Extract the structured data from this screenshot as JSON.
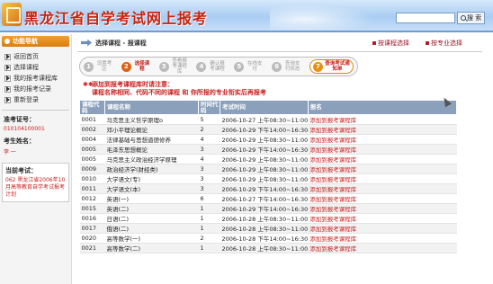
{
  "header": {
    "title": "黑龙江省自学考试网上报考",
    "search_value": "",
    "search_button": "搜 索"
  },
  "sidebar": {
    "heading": "功能导航",
    "items": [
      {
        "label": "返回首页"
      },
      {
        "label": "选择课程"
      },
      {
        "label": "我的报考课程库"
      },
      {
        "label": "我的报考记录"
      },
      {
        "label": "重新登录"
      }
    ],
    "exam_id_label": "准考证号：",
    "exam_id_value": "010104100001",
    "name_label": "考生姓名：",
    "name_value": "李 一",
    "notice_title": "当前考试：",
    "notice_text": "062 黑龙江省2006年10月高等教育自学考试报考计划"
  },
  "main": {
    "breadcrumb": "选择课程 - 报课程",
    "link_by_course": "按课程选择",
    "link_by_major": "按专业选择",
    "steps": [
      {
        "num": "1",
        "label": "设置考区",
        "state": "done"
      },
      {
        "num": "2",
        "label": "选择课程",
        "state": "active"
      },
      {
        "num": "3",
        "label": "查看报考课程库",
        "state": "todo"
      },
      {
        "num": "4",
        "label": "确认报考课程",
        "state": "todo"
      },
      {
        "num": "5",
        "label": "在线支付",
        "state": "todo"
      },
      {
        "num": "6",
        "label": "查询支付状态",
        "state": "todo"
      },
      {
        "num": "7",
        "label": "查询考试通知单",
        "state": "final"
      }
    ],
    "warning_line1": "添加到报考课程库时请注意：",
    "warning_line2": "课程名称相同、代码不同的课程 和 你所报的专业衔实后再报考",
    "table": {
      "headers": [
        "课程代码",
        "课程名称",
        "时间代码",
        "考试时间",
        "报名"
      ],
      "rows": [
        [
          "0001",
          "马克思主义哲学原理o",
          "5",
          "2006-10-27 上午08:30~11:00",
          "添加到报考课程库"
        ],
        [
          "0002",
          "邓小平理论概论",
          "2",
          "2006-10-29 下午14:00~16:30",
          "添加到报考课程库"
        ],
        [
          "0004",
          "法律基础与思想道德修养",
          "4",
          "2006-10-29 上午08:30~11:00",
          "添加到报考课程库"
        ],
        [
          "0005",
          "毛泽东思想概论",
          "3",
          "2006-10-29 下午14:00~16:30",
          "添加到报考课程库"
        ],
        [
          "0005",
          "马克思主义政治经济学原理",
          "4",
          "2006-10-29 上午08:30~11:00",
          "添加到报考课程库"
        ],
        [
          "0009",
          "政治经济学(财经类)",
          "3",
          "2006-10-29 上午08:30~11:00",
          "添加到报考课程库"
        ],
        [
          "0010",
          "大学语文(专)",
          "3",
          "2006-10-29 上午08:30~11:00",
          "添加到报考课程库"
        ],
        [
          "0011",
          "大学语文(本)",
          "3",
          "2006-10-29 下午14:00~16:30",
          "添加到报考课程库"
        ],
        [
          "0012",
          "英语(一)",
          "6",
          "2006-10-27 下午14:00~16:30",
          "添加到报考课程库"
        ],
        [
          "0015",
          "英语(二)",
          "1",
          "2006-10-29 下午14:00~16:30",
          "添加到报考课程库"
        ],
        [
          "0016",
          "日语(二)",
          "1",
          "2006-10-28 上午08:30~11:00",
          "添加到报考课程库"
        ],
        [
          "0017",
          "俄语(二)",
          "1",
          "2006-10-28 上午08:30~11:00",
          "添加到报考课程库"
        ],
        [
          "0020",
          "高等数学(一)",
          "2",
          "2006-10-28 下午14:00~16:30",
          "添加到报考课程库"
        ],
        [
          "0021",
          "高等数学(二)",
          "1",
          "2006-10-28 上午08:30~11:00",
          "添加到报考课程库"
        ]
      ]
    }
  }
}
